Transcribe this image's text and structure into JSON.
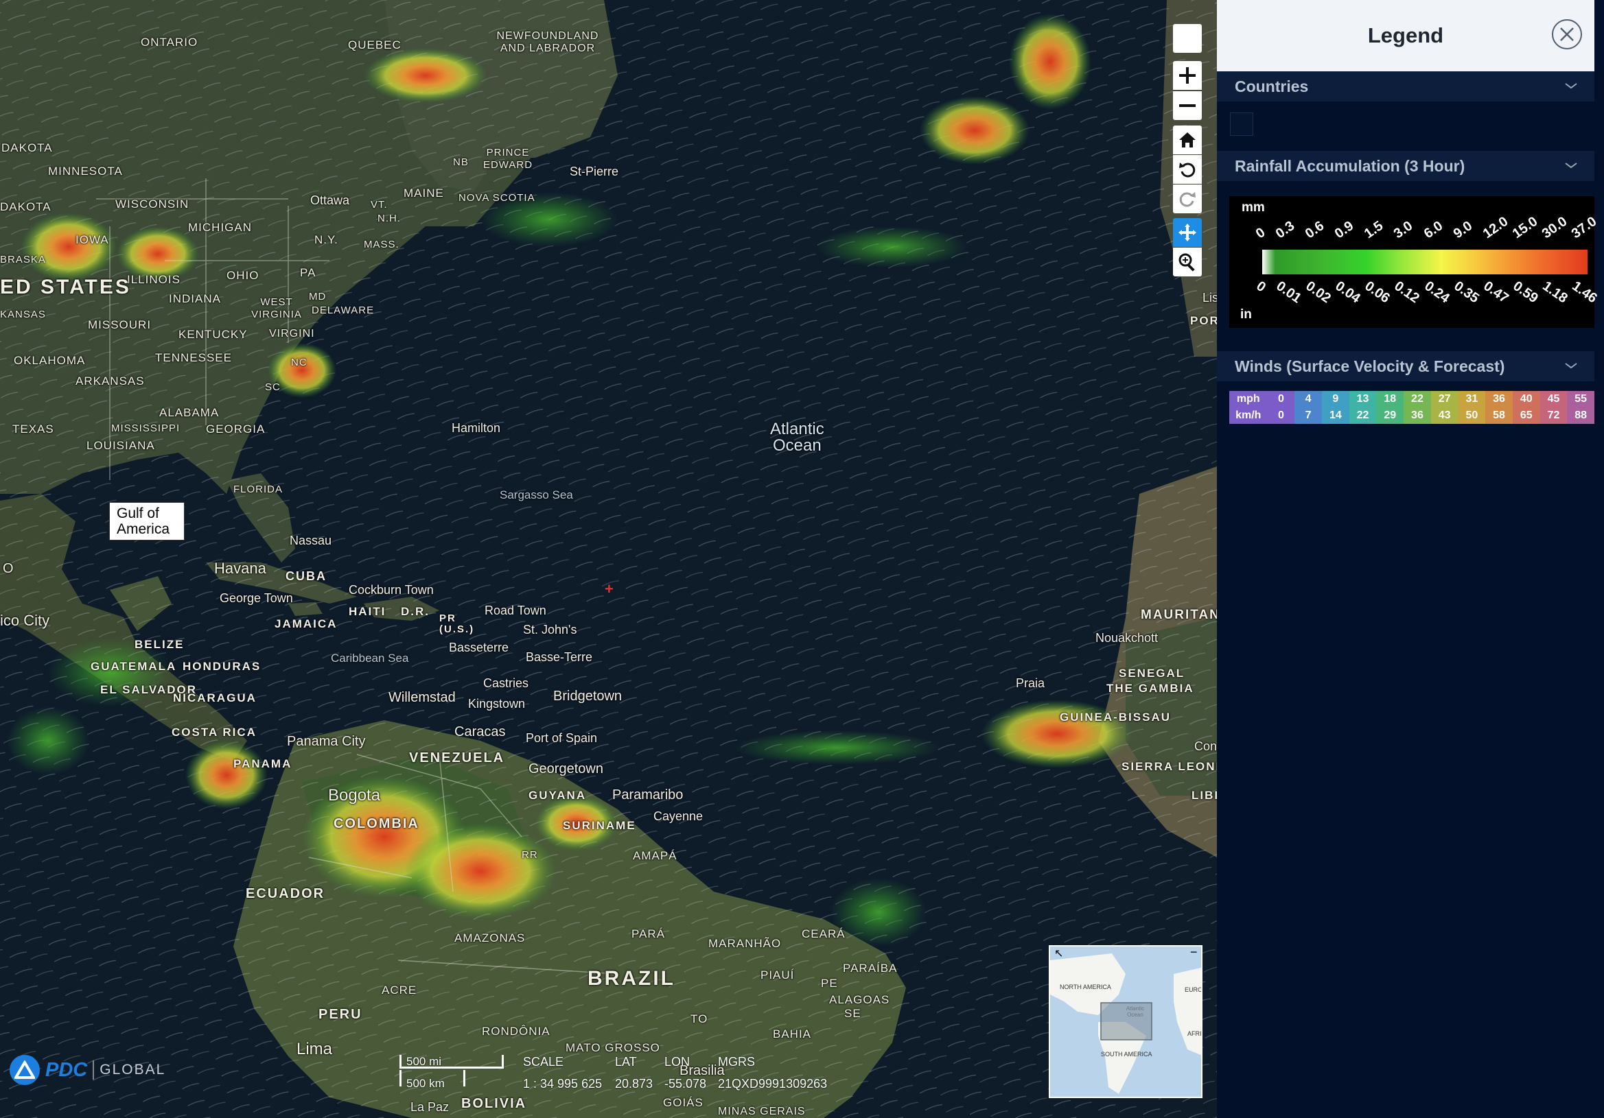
{
  "map": {
    "labels_states": [
      "ONTARIO",
      "QUEBEC",
      "NEWFOUNDLAND AND LABRADOR",
      "DAKOTA",
      "MINNESOTA",
      "WISCONSIN",
      "MICHIGAN",
      "IOWA",
      "ILLINOIS",
      "INDIANA",
      "OHIO",
      "PA",
      "N.Y.",
      "VT.",
      "N.H.",
      "MAINE",
      "MASS.",
      "MD",
      "DELAWARE",
      "WEST VIRGINIA",
      "VIRGINI",
      "KENTUCKY",
      "MISSOURI",
      "KANSAS",
      "OKLAHOMA",
      "TENNESSEE",
      "ARKANSAS",
      "ALABAMA",
      "GEORGIA",
      "MISSISSIPPI",
      "LOUISIANA",
      "TEXAS",
      "FLORIDA",
      "NB",
      "PRINCE EDWARD",
      "NOVA SCOTIA",
      "DAKOTA",
      "BRASKA",
      "NC",
      "SC",
      "AMAZONAS",
      "PARÁ",
      "MARANHÃO",
      "CEARÁ",
      "PIAUÍ",
      "PARAÍBA",
      "PE",
      "ALAGOAS",
      "SE",
      "BAHIA",
      "TO",
      "ACRE",
      "RONDÔNIA",
      "MATO GROSSO",
      "GOIÁS",
      "MINAS GERAIS",
      "AMAPÁ",
      "RR"
    ],
    "labels_countries": [
      "ED STATES",
      "CUBA",
      "HAITI",
      "D.R.",
      "JAMAICA",
      "BELIZE",
      "GUATEMALA",
      "HONDURAS",
      "EL SALVADOR",
      "NICARAGUA",
      "COSTA RICA",
      "PANAMA",
      "VENEZUELA",
      "COLOMBIA",
      "GUYANA",
      "SURINAME",
      "ECUADOR",
      "PERU",
      "BOLIVIA",
      "BRAZIL",
      "MAURITANIA",
      "SENEGAL",
      "THE GAMBIA",
      "GUINEA-BISSAU",
      "SIERRA LEONE",
      "LIBERIA",
      "PR (U.S.)",
      "POR"
    ],
    "labels_cities": [
      "Ottawa",
      "St-Pierre",
      "Hamilton",
      "Nassau",
      "Havana",
      "George Town",
      "Cockburn Town",
      "Road Town",
      "St. John's",
      "Basseterre",
      "Basse-Terre",
      "Castries",
      "Bridgetown",
      "Willemstad",
      "Kingstown",
      "Caracas",
      "Port of Spain",
      "Georgetown",
      "Paramaribo",
      "Cayenne",
      "Panama City",
      "Bogota",
      "Lima",
      "Brasilia",
      "La Paz",
      "Praia",
      "Nouakchott",
      "Conakry",
      "Lisboa",
      "ico City",
      "O"
    ],
    "ocean_label": [
      "Atlantic",
      "Ocean"
    ],
    "sea_labels": [
      "Sargasso Sea",
      "Caribbean Sea"
    ],
    "gulf_label": [
      "Gulf of",
      "America"
    ],
    "toolbar": [
      "blank-button",
      "zoom-in",
      "zoom-out",
      "home",
      "rotate-left",
      "rotate-right",
      "pan",
      "zoom-box"
    ]
  },
  "bottom": {
    "logo_text": "PDC",
    "logo_global": "GLOBAL",
    "scale_mi": "500 mi",
    "scale_km": "500 km",
    "scale_label": "SCALE",
    "scale_value": "1 : 34 995 625",
    "lat_label": "LAT",
    "lat_value": "20.873",
    "lon_label": "LON",
    "lon_value": "-55.078",
    "mgrs_label": "MGRS",
    "mgrs_value": "21QXD9991309263"
  },
  "overview": {
    "north_america": "NORTH AMERICA",
    "south_america": "SOUTH AMERICA",
    "atlantic": "Atlantic Ocean",
    "europe": "EUROP",
    "africa": "AFRIC",
    "minimize": "−",
    "expand": "↖"
  },
  "legend": {
    "title": "Legend",
    "sections": {
      "countries": "Countries",
      "rainfall": "Rainfall Accumulation (3 Hour)",
      "winds": "Winds (Surface Velocity & Forecast)"
    },
    "rain_mm_unit": "mm",
    "rain_in_unit": "in",
    "rain_mm_ticks": [
      "0",
      "0.3",
      "0.6",
      "0.9",
      "1.5",
      "3.0",
      "6.0",
      "9.0",
      "12.0",
      "15.0",
      "30.0",
      "37.0"
    ],
    "rain_in_ticks": [
      "0",
      "0.01",
      "0.02",
      "0.04",
      "0.06",
      "0.12",
      "0.24",
      "0.35",
      "0.47",
      "0.59",
      "1.18",
      "1.46"
    ],
    "wind_mph_label": "mph",
    "wind_kmh_label": "km/h",
    "wind_mph": [
      "0",
      "4",
      "9",
      "13",
      "18",
      "22",
      "27",
      "31",
      "36",
      "40",
      "45",
      "55"
    ],
    "wind_kmh": [
      "0",
      "7",
      "14",
      "22",
      "29",
      "36",
      "43",
      "50",
      "58",
      "65",
      "72",
      "88"
    ],
    "wind_colors": [
      "#7b5cc8",
      "#4b86cc",
      "#3fa0c4",
      "#3fb4a6",
      "#49b77c",
      "#75b752",
      "#a8b444",
      "#c9a43e",
      "#d08a44",
      "#cf6f5e",
      "#c4657c",
      "#a9609c"
    ]
  }
}
